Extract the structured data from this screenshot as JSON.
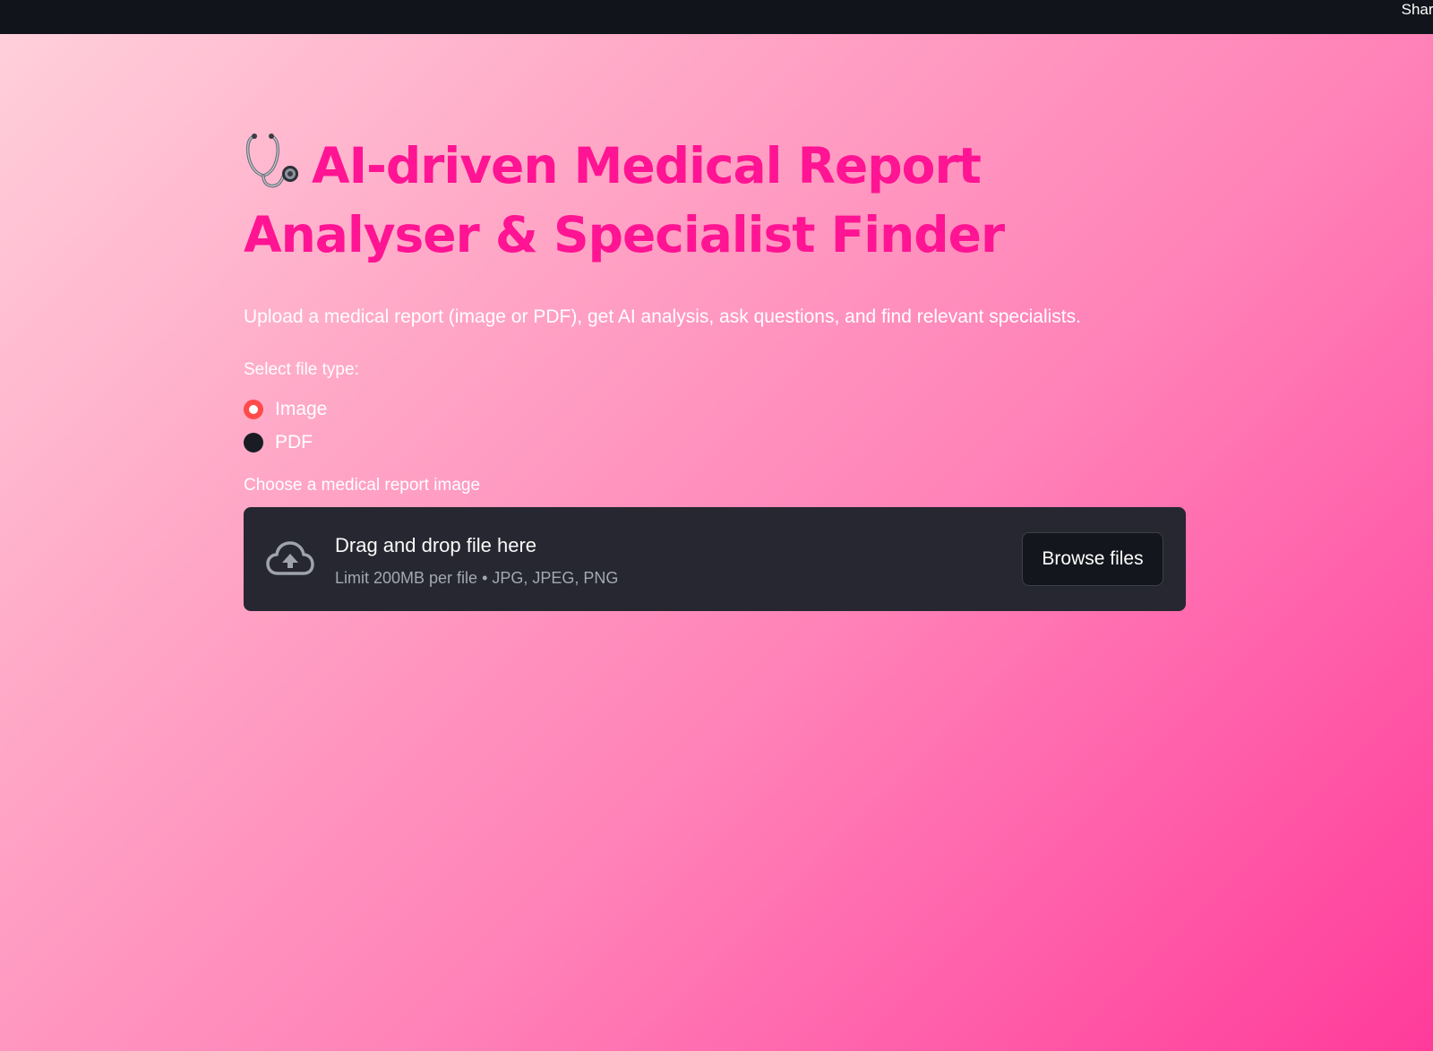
{
  "header": {
    "share_label": "Share"
  },
  "title": {
    "icon": "stethoscope-icon",
    "line1": "AI-driven Medical Report",
    "line2": "Analyser & Specialist Finder"
  },
  "subtitle": "Upload a medical report (image or PDF), get AI analysis, ask questions, and find relevant specialists.",
  "file_type": {
    "label": "Select file type:",
    "options": [
      {
        "label": "Image",
        "selected": true
      },
      {
        "label": "PDF",
        "selected": false
      }
    ]
  },
  "uploader": {
    "label": "Choose a medical report image",
    "icon": "cloud-upload-icon",
    "drop_text": "Drag and drop file here",
    "limit_text": "Limit 200MB per file • JPG, JPEG, PNG",
    "browse_label": "Browse files"
  },
  "colors": {
    "title": "#ff1493",
    "radio_accent": "#ff4b4b",
    "topbar": "#11141b",
    "uploader_bg": "#262730"
  }
}
